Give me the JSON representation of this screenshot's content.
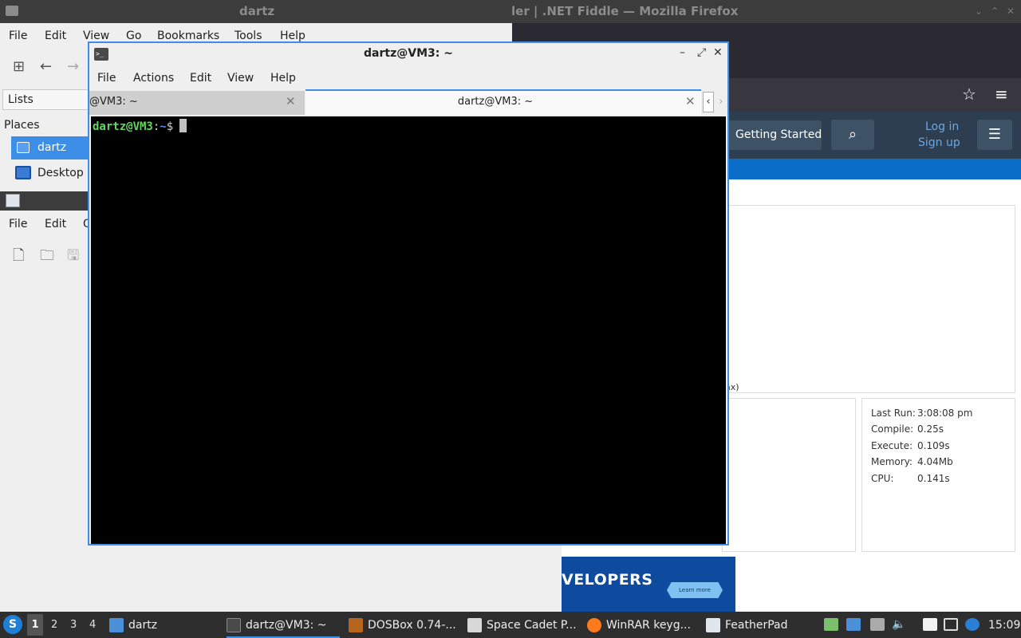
{
  "firefox": {
    "title": "ler | .NET Fiddle — Mozilla Firefox",
    "window_buttons": [
      "⌄",
      "⌃",
      "✕"
    ],
    "header": {
      "getting_started": "Getting Started",
      "search_icon": "search-icon",
      "login": "Log in",
      "signup": "Sign up",
      "menu_icon": "hamburger-icon"
    },
    "output_fragment": "ax)",
    "stats": [
      {
        "label": "Last Run:",
        "value": "3:08:08 pm"
      },
      {
        "label": "Compile:",
        "value": "0.25s"
      },
      {
        "label": "Execute:",
        "value": "0.109s"
      },
      {
        "label": "Memory:",
        "value": "4.04Mb"
      },
      {
        "label": "CPU:",
        "value": "0.141s"
      }
    ],
    "ad": {
      "text": "VELOPERS",
      "button": "Learn more"
    }
  },
  "filemanager": {
    "title": "dartz",
    "menu": [
      "File",
      "Edit",
      "View",
      "Go",
      "Bookmarks",
      "Tools",
      "Help"
    ],
    "side_pane_mode": "Lists",
    "places_header": "Places",
    "places": [
      "dartz",
      "Desktop"
    ]
  },
  "featherpad": {
    "menu": [
      "File",
      "Edit",
      "O"
    ]
  },
  "terminal": {
    "title": "dartz@VM3: ~",
    "menu": [
      "File",
      "Actions",
      "Edit",
      "View",
      "Help"
    ],
    "tabs": [
      {
        "label": "@VM3: ~",
        "active": false
      },
      {
        "label": "dartz@VM3: ~",
        "active": true
      }
    ],
    "prompt": {
      "user": "dartz@VM3",
      "sep": ":",
      "path": "~",
      "symbol": "$"
    }
  },
  "taskbar": {
    "desktops": [
      "1",
      "2",
      "3",
      "4"
    ],
    "tasks": [
      {
        "label": "dartz",
        "icon": "folder-icon"
      },
      {
        "label": "dartz@VM3: ~",
        "icon": "terminal-icon"
      },
      {
        "label": "DOSBox 0.74-...",
        "icon": "dosbox-icon"
      },
      {
        "label": "Space Cadet P...",
        "icon": "pinball-icon"
      },
      {
        "label": "WinRAR keyg...",
        "icon": "firefox-icon"
      },
      {
        "label": "FeatherPad",
        "icon": "featherpad-icon"
      }
    ],
    "clock": "15:09"
  },
  "colors": {
    "accent": "#3d8ee6",
    "prompt_user": "#5fd75f",
    "prompt_path": "#5f87ff",
    "site_header": "#2c3e50",
    "site_blue": "#0a6ec8"
  }
}
